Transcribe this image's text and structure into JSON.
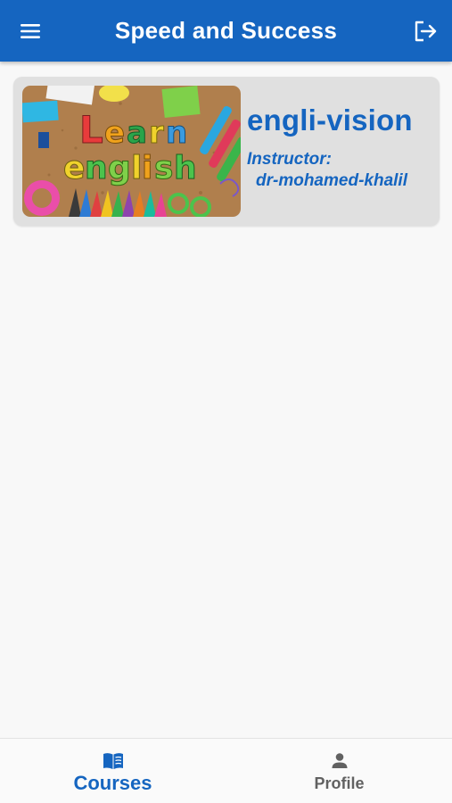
{
  "app_bar": {
    "title": "Speed and Success",
    "menu_icon": "hamburger-menu-icon",
    "logout_icon": "logout-icon",
    "color": "#1565c0"
  },
  "courses": [
    {
      "title": "engli-vision",
      "instructor_label": "Instructor:",
      "instructor_name": "dr-mohamed-khalil",
      "thumbnail_text": [
        "Learn",
        "english"
      ]
    }
  ],
  "bottom_nav": {
    "items": [
      {
        "label": "Courses",
        "icon": "book-icon",
        "active": true
      },
      {
        "label": "Profile",
        "icon": "person-icon",
        "active": false
      }
    ]
  },
  "colors": {
    "primary": "#1565c0",
    "inactive": "#616161",
    "card": "#e0e0e0",
    "background": "#f8f8f8"
  }
}
